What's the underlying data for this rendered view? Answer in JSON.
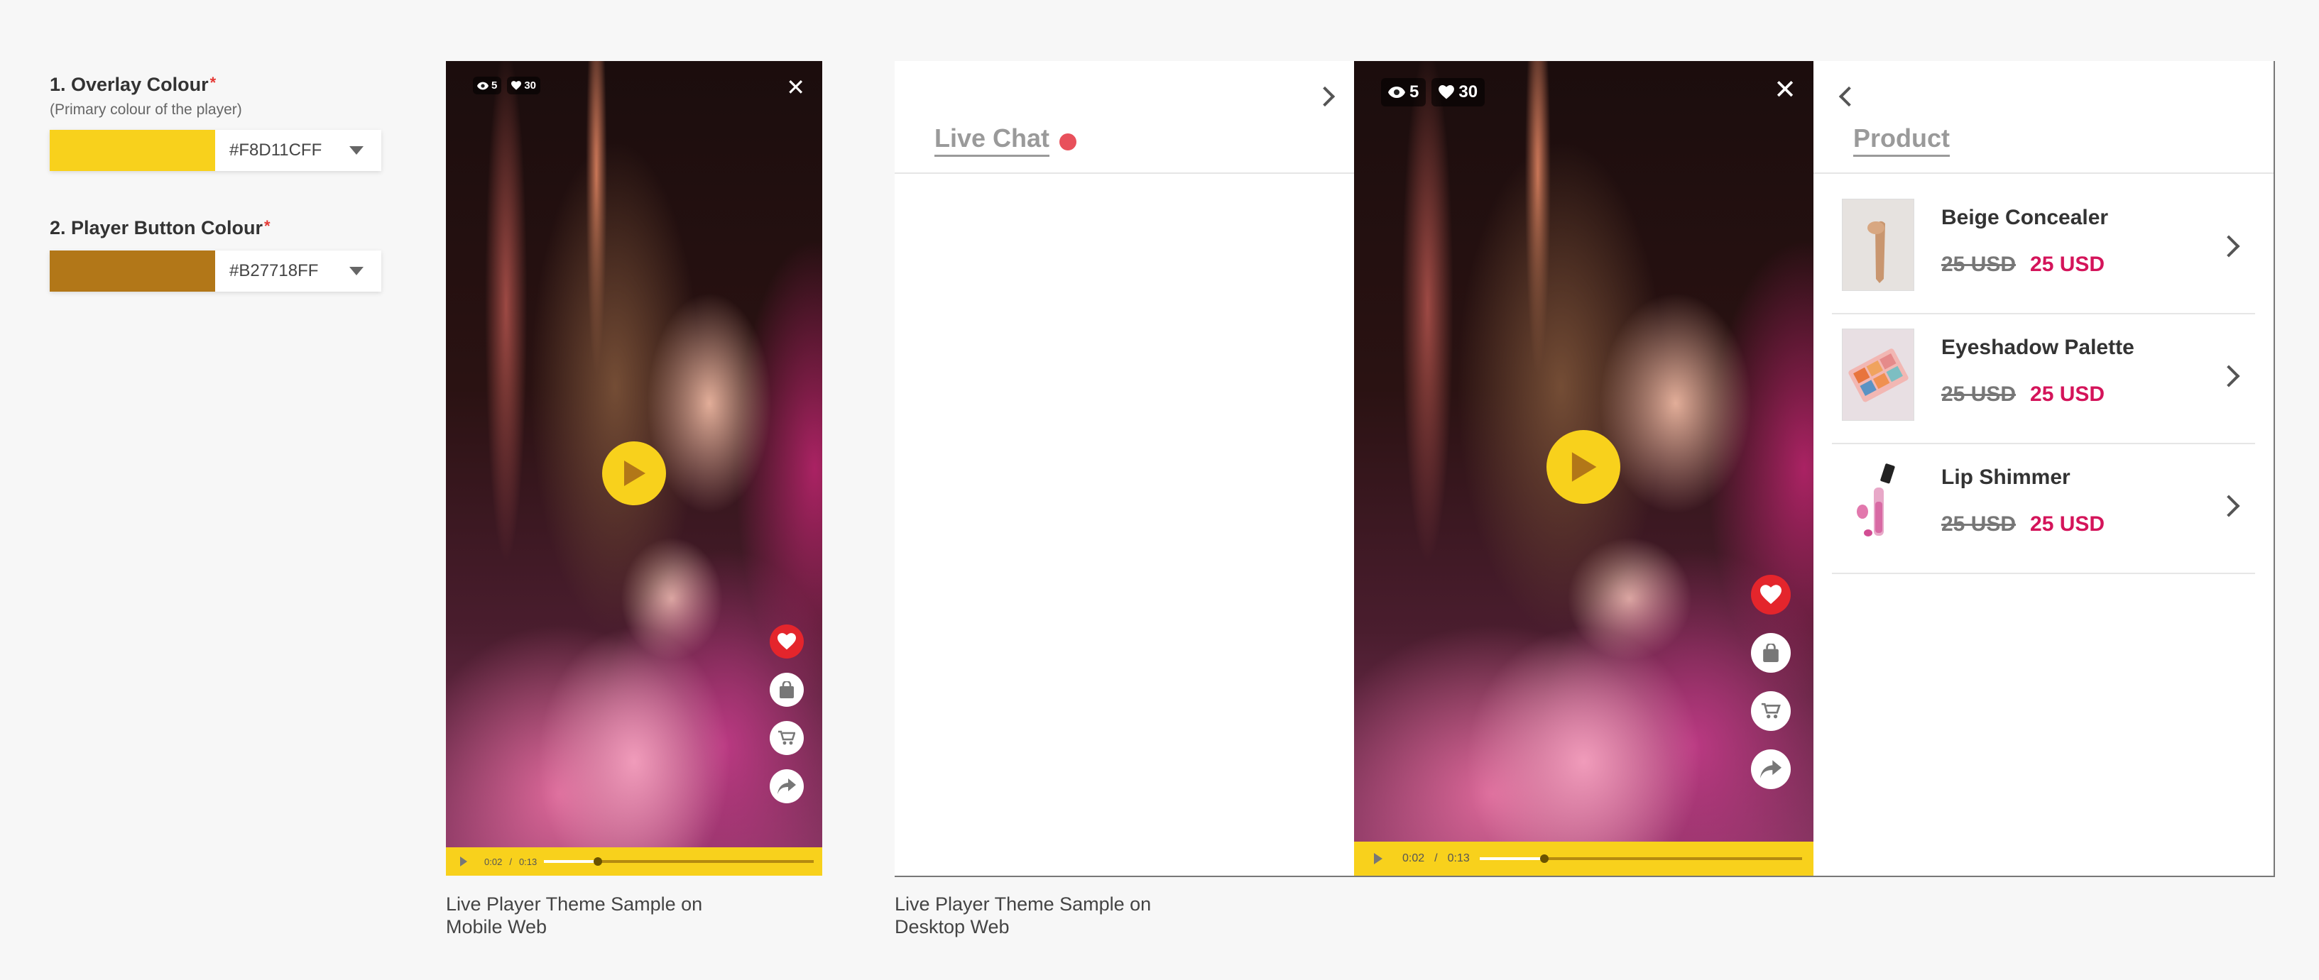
{
  "settings": {
    "overlay": {
      "title": "1. Overlay Colour",
      "required_mark": "*",
      "subtitle": "(Primary colour of the player)",
      "hex": "#F8D11CFF",
      "color": "#F8D11C"
    },
    "button": {
      "title": "2. Player Button Colour",
      "required_mark": "*",
      "hex": "#B27718FF",
      "color": "#B27718"
    }
  },
  "player": {
    "views": "5",
    "likes": "30",
    "time_current": "0:02",
    "time_separator": "/",
    "time_total": "0:13",
    "progress": 0.2,
    "overlay_color": "#F8D11C",
    "icons": [
      "eye-icon",
      "heart-icon",
      "close-icon",
      "play-icon",
      "heart-icon",
      "bag-icon",
      "cart-icon",
      "share-icon"
    ]
  },
  "mobile": {
    "caption": "Live Player Theme Sample on Mobile Web"
  },
  "desktop": {
    "caption": "Live Player Theme Sample on Desktop Web",
    "chat_tab": "Live Chat",
    "product_tab": "Product",
    "products": [
      {
        "name": "Beige Concealer",
        "old_price": "25 USD",
        "new_price": "25  USD"
      },
      {
        "name": "Eyeshadow Palette",
        "old_price": "25 USD",
        "new_price": "25  USD"
      },
      {
        "name": "Lip Shimmer",
        "old_price": "25 USD",
        "new_price": "25  USD"
      }
    ]
  }
}
